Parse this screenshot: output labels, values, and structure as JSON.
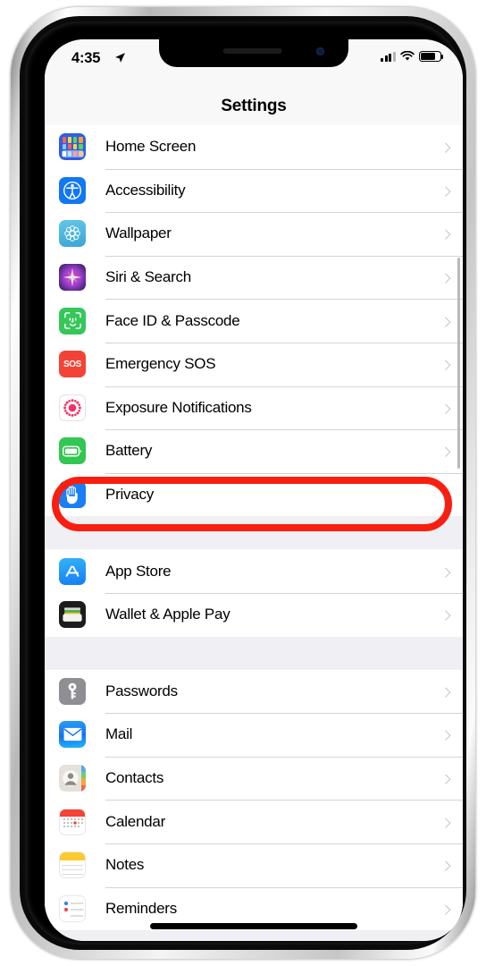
{
  "status_bar": {
    "time": "4:35",
    "location_icon": "location-arrow-icon",
    "cellular_icon": "cellular-signal-icon",
    "wifi_icon": "wifi-icon",
    "battery_icon": "battery-icon"
  },
  "nav": {
    "title": "Settings"
  },
  "annotation": {
    "type": "oval-highlight",
    "color": "#f81f11",
    "target": "Privacy"
  },
  "groups": [
    {
      "id": "group-system",
      "rows": [
        {
          "label": "Home Screen",
          "icon": "home-screen-icon",
          "chevron": "chevron-right-icon"
        },
        {
          "label": "Accessibility",
          "icon": "accessibility-icon",
          "chevron": "chevron-right-icon"
        },
        {
          "label": "Wallpaper",
          "icon": "wallpaper-icon",
          "chevron": "chevron-right-icon"
        },
        {
          "label": "Siri & Search",
          "icon": "siri-icon",
          "chevron": "chevron-right-icon"
        },
        {
          "label": "Face ID & Passcode",
          "icon": "face-id-icon",
          "chevron": "chevron-right-icon"
        },
        {
          "label": "Emergency SOS",
          "icon": "emergency-sos-icon",
          "chevron": "chevron-right-icon"
        },
        {
          "label": "Exposure Notifications",
          "icon": "exposure-notifications-icon",
          "chevron": "chevron-right-icon"
        },
        {
          "label": "Battery",
          "icon": "battery-settings-icon",
          "chevron": "chevron-right-icon"
        },
        {
          "label": "Privacy",
          "icon": "privacy-hand-icon",
          "chevron": "chevron-right-icon"
        }
      ]
    },
    {
      "id": "group-store",
      "rows": [
        {
          "label": "App Store",
          "icon": "app-store-icon",
          "chevron": "chevron-right-icon"
        },
        {
          "label": "Wallet & Apple Pay",
          "icon": "wallet-icon",
          "chevron": "chevron-right-icon"
        }
      ]
    },
    {
      "id": "group-apps",
      "rows": [
        {
          "label": "Passwords",
          "icon": "passwords-key-icon",
          "chevron": "chevron-right-icon"
        },
        {
          "label": "Mail",
          "icon": "mail-icon",
          "chevron": "chevron-right-icon"
        },
        {
          "label": "Contacts",
          "icon": "contacts-icon",
          "chevron": "chevron-right-icon"
        },
        {
          "label": "Calendar",
          "icon": "calendar-icon",
          "chevron": "chevron-right-icon"
        },
        {
          "label": "Notes",
          "icon": "notes-icon",
          "chevron": "chevron-right-icon"
        },
        {
          "label": "Reminders",
          "icon": "reminders-icon",
          "chevron": "chevron-right-icon"
        }
      ]
    }
  ],
  "colors": {
    "annotation_red": "#f81f11",
    "list_background": "#efeff4",
    "row_background": "#ffffff",
    "separator": "#d4d4d6",
    "chevron": "#c3c3c7"
  }
}
